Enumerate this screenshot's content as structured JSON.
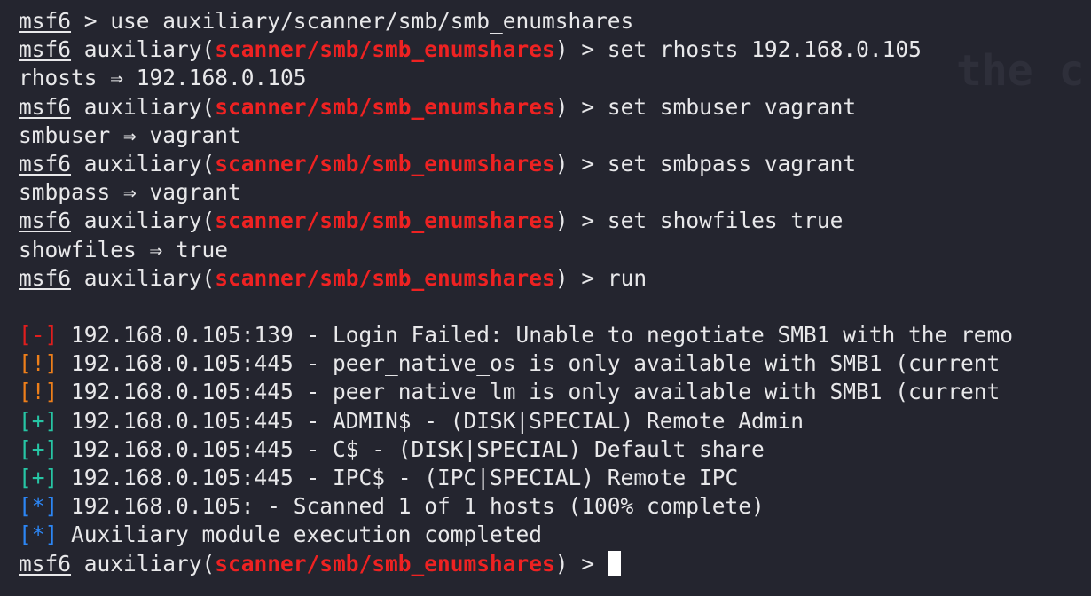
{
  "prompt": {
    "msf": "msf6",
    "aux_prefix": "auxiliary(",
    "aux_suffix": ") > ",
    "plain_gt": " > ",
    "module": "scanner/smb/smb_enumshares"
  },
  "watermark": "the c",
  "commands": {
    "use": "use auxiliary/scanner/smb/smb_enumshares",
    "set_rhosts": "set rhosts 192.168.0.105",
    "set_smbuser": "set smbuser vagrant",
    "set_smbpass": "set smbpass vagrant",
    "set_showfiles": "set showfiles true",
    "run": "run"
  },
  "echoes": {
    "rhosts": "rhosts ⇒ 192.168.0.105",
    "smbuser": "smbuser ⇒ vagrant",
    "smbpass": "smbpass ⇒ vagrant",
    "showfiles": "showfiles ⇒ true"
  },
  "output": [
    {
      "tag": "[-]",
      "level": "error",
      "text": "192.168.0.105:139 - Login Failed: Unable to negotiate SMB1 with the remo"
    },
    {
      "tag": "[!]",
      "level": "warning",
      "text": "192.168.0.105:445 - peer_native_os is only available with SMB1 (current"
    },
    {
      "tag": "[!]",
      "level": "warning",
      "text": "192.168.0.105:445 - peer_native_lm is only available with SMB1 (current"
    },
    {
      "tag": "[+]",
      "level": "good",
      "text": "192.168.0.105:445 - ADMIN$ - (DISK|SPECIAL) Remote Admin"
    },
    {
      "tag": "[+]",
      "level": "good",
      "text": "192.168.0.105:445 - C$ - (DISK|SPECIAL) Default share"
    },
    {
      "tag": "[+]",
      "level": "good",
      "text": "192.168.0.105:445 - IPC$ - (IPC|SPECIAL) Remote IPC"
    },
    {
      "tag": "[*]",
      "level": "info",
      "text": "192.168.0.105: - Scanned 1 of 1 hosts (100% complete)"
    },
    {
      "tag": "[*]",
      "level": "info",
      "text": "Auxiliary module execution completed"
    }
  ],
  "colors": {
    "background": "#24252f",
    "foreground": "#e8e8ea",
    "module": "#ee2222",
    "error": "#e01e1e",
    "warning": "#ee7f1a",
    "good": "#27c6a5",
    "info": "#2c86f5"
  }
}
